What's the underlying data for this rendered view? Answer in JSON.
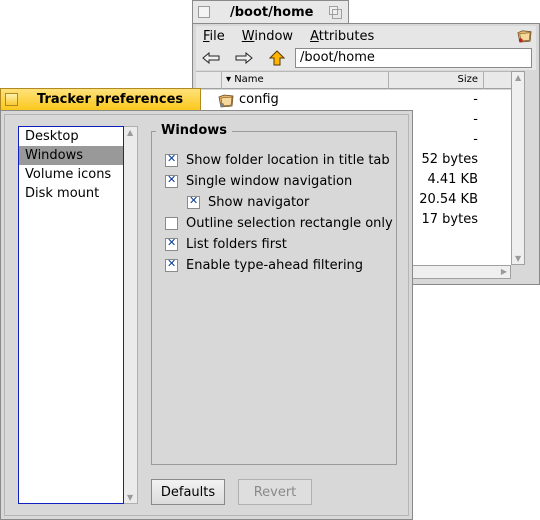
{
  "tracker_window": {
    "title": "/boot/home",
    "menu": [
      {
        "label": "File",
        "mnemonic": "F",
        "rest": "ile"
      },
      {
        "label": "Window",
        "mnemonic": "W",
        "rest": "indow"
      },
      {
        "label": "Attributes",
        "mnemonic": "A",
        "rest": "ttributes"
      }
    ],
    "nav": {
      "back_icon": "back-arrow-icon",
      "forward_icon": "forward-arrow-icon",
      "up_icon": "up-arrow-icon"
    },
    "path": "/boot/home",
    "columns": {
      "name": "Name",
      "size": "Size"
    },
    "files": [
      {
        "name": "config",
        "size": "-",
        "icon": "folder-icon"
      },
      {
        "name": "",
        "size": "-"
      },
      {
        "name": "",
        "size": "-"
      },
      {
        "name": "",
        "size": "52 bytes"
      },
      {
        "name": "",
        "size": "4.41 KB"
      },
      {
        "name": "",
        "size": "20.54 KB"
      },
      {
        "name": "",
        "size": "17 bytes"
      }
    ]
  },
  "prefs_window": {
    "title": "Tracker preferences",
    "categories": [
      {
        "label": "Desktop",
        "selected": false
      },
      {
        "label": "Windows",
        "selected": true
      },
      {
        "label": "Volume icons",
        "selected": false
      },
      {
        "label": "Disk mount",
        "selected": false
      }
    ],
    "group_title": "Windows",
    "options": [
      {
        "label": "Show folder location in title tab",
        "checked": true,
        "indent": 0
      },
      {
        "label": "Single window navigation",
        "checked": true,
        "indent": 0
      },
      {
        "label": "Show navigator",
        "checked": true,
        "indent": 1
      },
      {
        "label": "Outline selection rectangle only",
        "checked": false,
        "indent": 0
      },
      {
        "label": "List folders first",
        "checked": true,
        "indent": 0
      },
      {
        "label": "Enable type-ahead filtering",
        "checked": true,
        "indent": 0
      }
    ],
    "buttons": {
      "defaults": "Defaults",
      "revert": "Revert"
    }
  }
}
